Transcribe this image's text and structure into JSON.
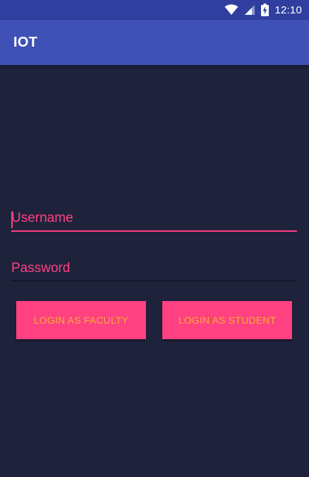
{
  "status_bar": {
    "time": "12:10",
    "icons": [
      "wifi-icon",
      "cellular-signal-icon",
      "battery-charging-icon"
    ]
  },
  "app_bar": {
    "title": "IOT"
  },
  "form": {
    "username": {
      "value": "",
      "placeholder": "Username"
    },
    "password": {
      "value": "",
      "placeholder": "Password"
    }
  },
  "buttons": {
    "faculty_label": "LOGIN AS FACULTY",
    "student_label": "LOGIN AS STUDENT"
  },
  "colors": {
    "status_bar": "#303f9f",
    "app_bar": "#3f51b5",
    "background": "#1e223b",
    "accent": "#ff4081",
    "button_text": "#f2b134"
  }
}
